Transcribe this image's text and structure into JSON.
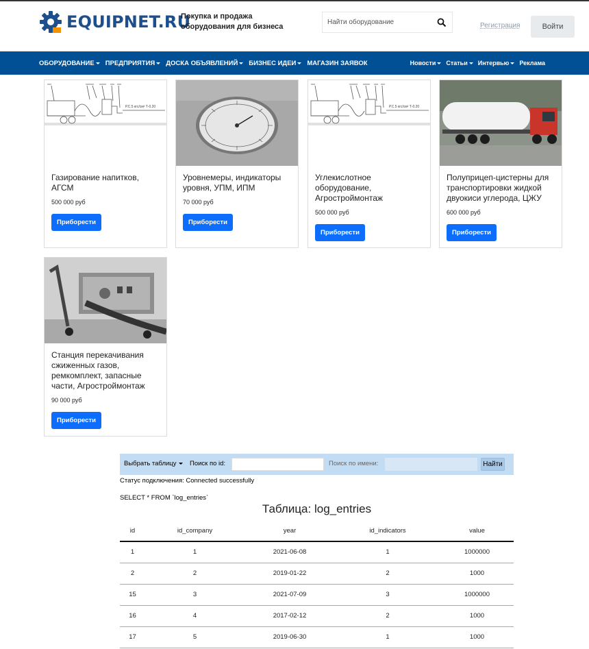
{
  "header": {
    "logo_text": "EQUIPNET.RU",
    "tagline_line1": "Покупка и продажа",
    "tagline_line2": "оборудования для бизнеса",
    "search_placeholder": "Найти оборудование",
    "register_label": "Регистрация",
    "login_label": "Войти"
  },
  "nav": {
    "left": [
      {
        "label": "ОБОРУДОВАНИЕ",
        "dropdown": true
      },
      {
        "label": "ПРЕДПРИЯТИЯ",
        "dropdown": true
      },
      {
        "label": "ДОСКА ОБЪЯВЛЕНИЙ",
        "dropdown": true
      },
      {
        "label": "БИЗНЕС ИДЕИ",
        "dropdown": true
      },
      {
        "label": "МАГАЗИН ЗАЯВОК",
        "dropdown": false
      }
    ],
    "right": [
      {
        "label": "Новости",
        "dropdown": true
      },
      {
        "label": "Статьи",
        "dropdown": true
      },
      {
        "label": "Интервью",
        "dropdown": true
      },
      {
        "label": "Реклама",
        "dropdown": false
      }
    ]
  },
  "cards": [
    {
      "title": "Газирование напитков, АГСМ",
      "price": "500 000 руб",
      "button": "Приборести",
      "image": "diagram"
    },
    {
      "title": "Уровнемеры, индикаторы уровня, УПМ, ИПМ",
      "price": "70 000 руб",
      "button": "Приборести",
      "image": "gauge"
    },
    {
      "title": "Углекислотное оборудование, Агростроймонтаж",
      "price": "500 000 руб",
      "button": "Приборести",
      "image": "diagram"
    },
    {
      "title": "Полуприцеп-цистерны для транспортировки жидкой двуокиси углерода, ЦЖУ",
      "price": "600 000 руб",
      "button": "Приборести",
      "image": "truck"
    },
    {
      "title": "Станция перекачивания сжиженных газов, ремкомплект, запасные части, Агростроймонтаж",
      "price": "90 000 руб",
      "button": "Приборести",
      "image": "machine"
    }
  ],
  "db": {
    "select_table_label": "Выбрать таблицу",
    "search_id_label": "Поиск по id:",
    "search_id_value": "",
    "search_name_label": "Поиск по имени:",
    "search_name_value": "",
    "find_button": "Найти",
    "status_text": "Статус подключения: Connected successfully",
    "sql_text": "SELECT * FROM `log_entries`",
    "table_title": "Таблица: log_entries",
    "columns": [
      "id",
      "id_company",
      "year",
      "id_indicators",
      "value"
    ],
    "rows": [
      [
        "1",
        "1",
        "2021-06-08",
        "1",
        "1000000"
      ],
      [
        "2",
        "2",
        "2019-01-22",
        "2",
        "1000"
      ],
      [
        "15",
        "3",
        "2021-07-09",
        "3",
        "1000000"
      ],
      [
        "16",
        "4",
        "2017-02-12",
        "2",
        "1000"
      ],
      [
        "17",
        "5",
        "2019-06-30",
        "1",
        "1000"
      ]
    ]
  },
  "colors": {
    "nav_bg": "#014f94",
    "logo_blue": "#1d4f8d",
    "logo_orange": "#f39200",
    "button_blue": "#0d6efd",
    "db_bar_bg": "#c2dcf3"
  }
}
